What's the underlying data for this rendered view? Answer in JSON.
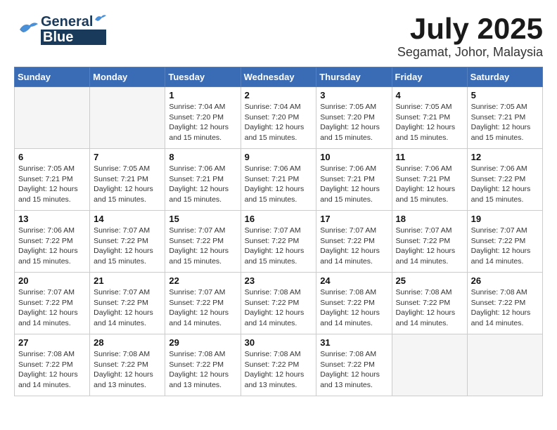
{
  "header": {
    "logo_general": "General",
    "logo_blue": "Blue",
    "month_year": "July 2025",
    "location": "Segamat, Johor, Malaysia"
  },
  "weekdays": [
    "Sunday",
    "Monday",
    "Tuesday",
    "Wednesday",
    "Thursday",
    "Friday",
    "Saturday"
  ],
  "weeks": [
    [
      {
        "day": "",
        "info": ""
      },
      {
        "day": "",
        "info": ""
      },
      {
        "day": "1",
        "info": "Sunrise: 7:04 AM\nSunset: 7:20 PM\nDaylight: 12 hours\nand 15 minutes."
      },
      {
        "day": "2",
        "info": "Sunrise: 7:04 AM\nSunset: 7:20 PM\nDaylight: 12 hours\nand 15 minutes."
      },
      {
        "day": "3",
        "info": "Sunrise: 7:05 AM\nSunset: 7:20 PM\nDaylight: 12 hours\nand 15 minutes."
      },
      {
        "day": "4",
        "info": "Sunrise: 7:05 AM\nSunset: 7:21 PM\nDaylight: 12 hours\nand 15 minutes."
      },
      {
        "day": "5",
        "info": "Sunrise: 7:05 AM\nSunset: 7:21 PM\nDaylight: 12 hours\nand 15 minutes."
      }
    ],
    [
      {
        "day": "6",
        "info": "Sunrise: 7:05 AM\nSunset: 7:21 PM\nDaylight: 12 hours\nand 15 minutes."
      },
      {
        "day": "7",
        "info": "Sunrise: 7:05 AM\nSunset: 7:21 PM\nDaylight: 12 hours\nand 15 minutes."
      },
      {
        "day": "8",
        "info": "Sunrise: 7:06 AM\nSunset: 7:21 PM\nDaylight: 12 hours\nand 15 minutes."
      },
      {
        "day": "9",
        "info": "Sunrise: 7:06 AM\nSunset: 7:21 PM\nDaylight: 12 hours\nand 15 minutes."
      },
      {
        "day": "10",
        "info": "Sunrise: 7:06 AM\nSunset: 7:21 PM\nDaylight: 12 hours\nand 15 minutes."
      },
      {
        "day": "11",
        "info": "Sunrise: 7:06 AM\nSunset: 7:21 PM\nDaylight: 12 hours\nand 15 minutes."
      },
      {
        "day": "12",
        "info": "Sunrise: 7:06 AM\nSunset: 7:22 PM\nDaylight: 12 hours\nand 15 minutes."
      }
    ],
    [
      {
        "day": "13",
        "info": "Sunrise: 7:06 AM\nSunset: 7:22 PM\nDaylight: 12 hours\nand 15 minutes."
      },
      {
        "day": "14",
        "info": "Sunrise: 7:07 AM\nSunset: 7:22 PM\nDaylight: 12 hours\nand 15 minutes."
      },
      {
        "day": "15",
        "info": "Sunrise: 7:07 AM\nSunset: 7:22 PM\nDaylight: 12 hours\nand 15 minutes."
      },
      {
        "day": "16",
        "info": "Sunrise: 7:07 AM\nSunset: 7:22 PM\nDaylight: 12 hours\nand 15 minutes."
      },
      {
        "day": "17",
        "info": "Sunrise: 7:07 AM\nSunset: 7:22 PM\nDaylight: 12 hours\nand 14 minutes."
      },
      {
        "day": "18",
        "info": "Sunrise: 7:07 AM\nSunset: 7:22 PM\nDaylight: 12 hours\nand 14 minutes."
      },
      {
        "day": "19",
        "info": "Sunrise: 7:07 AM\nSunset: 7:22 PM\nDaylight: 12 hours\nand 14 minutes."
      }
    ],
    [
      {
        "day": "20",
        "info": "Sunrise: 7:07 AM\nSunset: 7:22 PM\nDaylight: 12 hours\nand 14 minutes."
      },
      {
        "day": "21",
        "info": "Sunrise: 7:07 AM\nSunset: 7:22 PM\nDaylight: 12 hours\nand 14 minutes."
      },
      {
        "day": "22",
        "info": "Sunrise: 7:07 AM\nSunset: 7:22 PM\nDaylight: 12 hours\nand 14 minutes."
      },
      {
        "day": "23",
        "info": "Sunrise: 7:08 AM\nSunset: 7:22 PM\nDaylight: 12 hours\nand 14 minutes."
      },
      {
        "day": "24",
        "info": "Sunrise: 7:08 AM\nSunset: 7:22 PM\nDaylight: 12 hours\nand 14 minutes."
      },
      {
        "day": "25",
        "info": "Sunrise: 7:08 AM\nSunset: 7:22 PM\nDaylight: 12 hours\nand 14 minutes."
      },
      {
        "day": "26",
        "info": "Sunrise: 7:08 AM\nSunset: 7:22 PM\nDaylight: 12 hours\nand 14 minutes."
      }
    ],
    [
      {
        "day": "27",
        "info": "Sunrise: 7:08 AM\nSunset: 7:22 PM\nDaylight: 12 hours\nand 14 minutes."
      },
      {
        "day": "28",
        "info": "Sunrise: 7:08 AM\nSunset: 7:22 PM\nDaylight: 12 hours\nand 13 minutes."
      },
      {
        "day": "29",
        "info": "Sunrise: 7:08 AM\nSunset: 7:22 PM\nDaylight: 12 hours\nand 13 minutes."
      },
      {
        "day": "30",
        "info": "Sunrise: 7:08 AM\nSunset: 7:22 PM\nDaylight: 12 hours\nand 13 minutes."
      },
      {
        "day": "31",
        "info": "Sunrise: 7:08 AM\nSunset: 7:22 PM\nDaylight: 12 hours\nand 13 minutes."
      },
      {
        "day": "",
        "info": ""
      },
      {
        "day": "",
        "info": ""
      }
    ]
  ]
}
